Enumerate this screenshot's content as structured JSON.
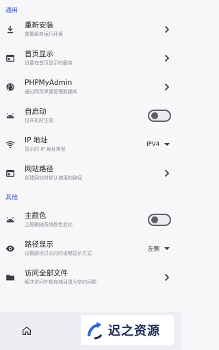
{
  "sections": {
    "general": "通用",
    "other": "其他"
  },
  "settings": {
    "reinstall": {
      "title": "重新安装",
      "subtitle": "重置服务运行环境",
      "icon": "download-icon"
    },
    "homepage": {
      "title": "首页显示",
      "subtitle": "设置在首页显示的服务",
      "icon": "window-icon"
    },
    "phpmyadmin": {
      "title": "PHPMyAdmin",
      "subtitle": "通过网页界面管理数据库",
      "icon": "globe-icon"
    },
    "autostart": {
      "title": "自启动",
      "subtitle": "仅开机时生效",
      "enabled": false,
      "icon": "android-icon"
    },
    "ip": {
      "title": "IP 地址",
      "subtitle": "显示的 IP 地址类型",
      "value": "IPV4",
      "icon": "wifi-icon"
    },
    "site_path": {
      "title": "网站路径",
      "subtitle": "创建网站时默认使用的路径",
      "icon": "window-icon"
    },
    "theme": {
      "title": "主题色",
      "subtitle": "主题跟随系统颜色变化",
      "enabled": false,
      "icon": "android-icon"
    },
    "path_display": {
      "title": "路径显示",
      "subtitle": "设置路径过长时的省略显示方式",
      "value": "左侧",
      "icon": "eye-icon"
    },
    "all_files": {
      "title": "访问全部文件",
      "subtitle": "解决访问外部存储目录为空的问题",
      "icon": "folder-icon"
    }
  },
  "bottom_nav": {
    "home_icon": "home-icon"
  },
  "watermark": {
    "text": "迟之资源"
  },
  "colors": {
    "accent": "#3b55d6",
    "background": "#f7f7f9",
    "bottom_bar": "#eceef4"
  }
}
